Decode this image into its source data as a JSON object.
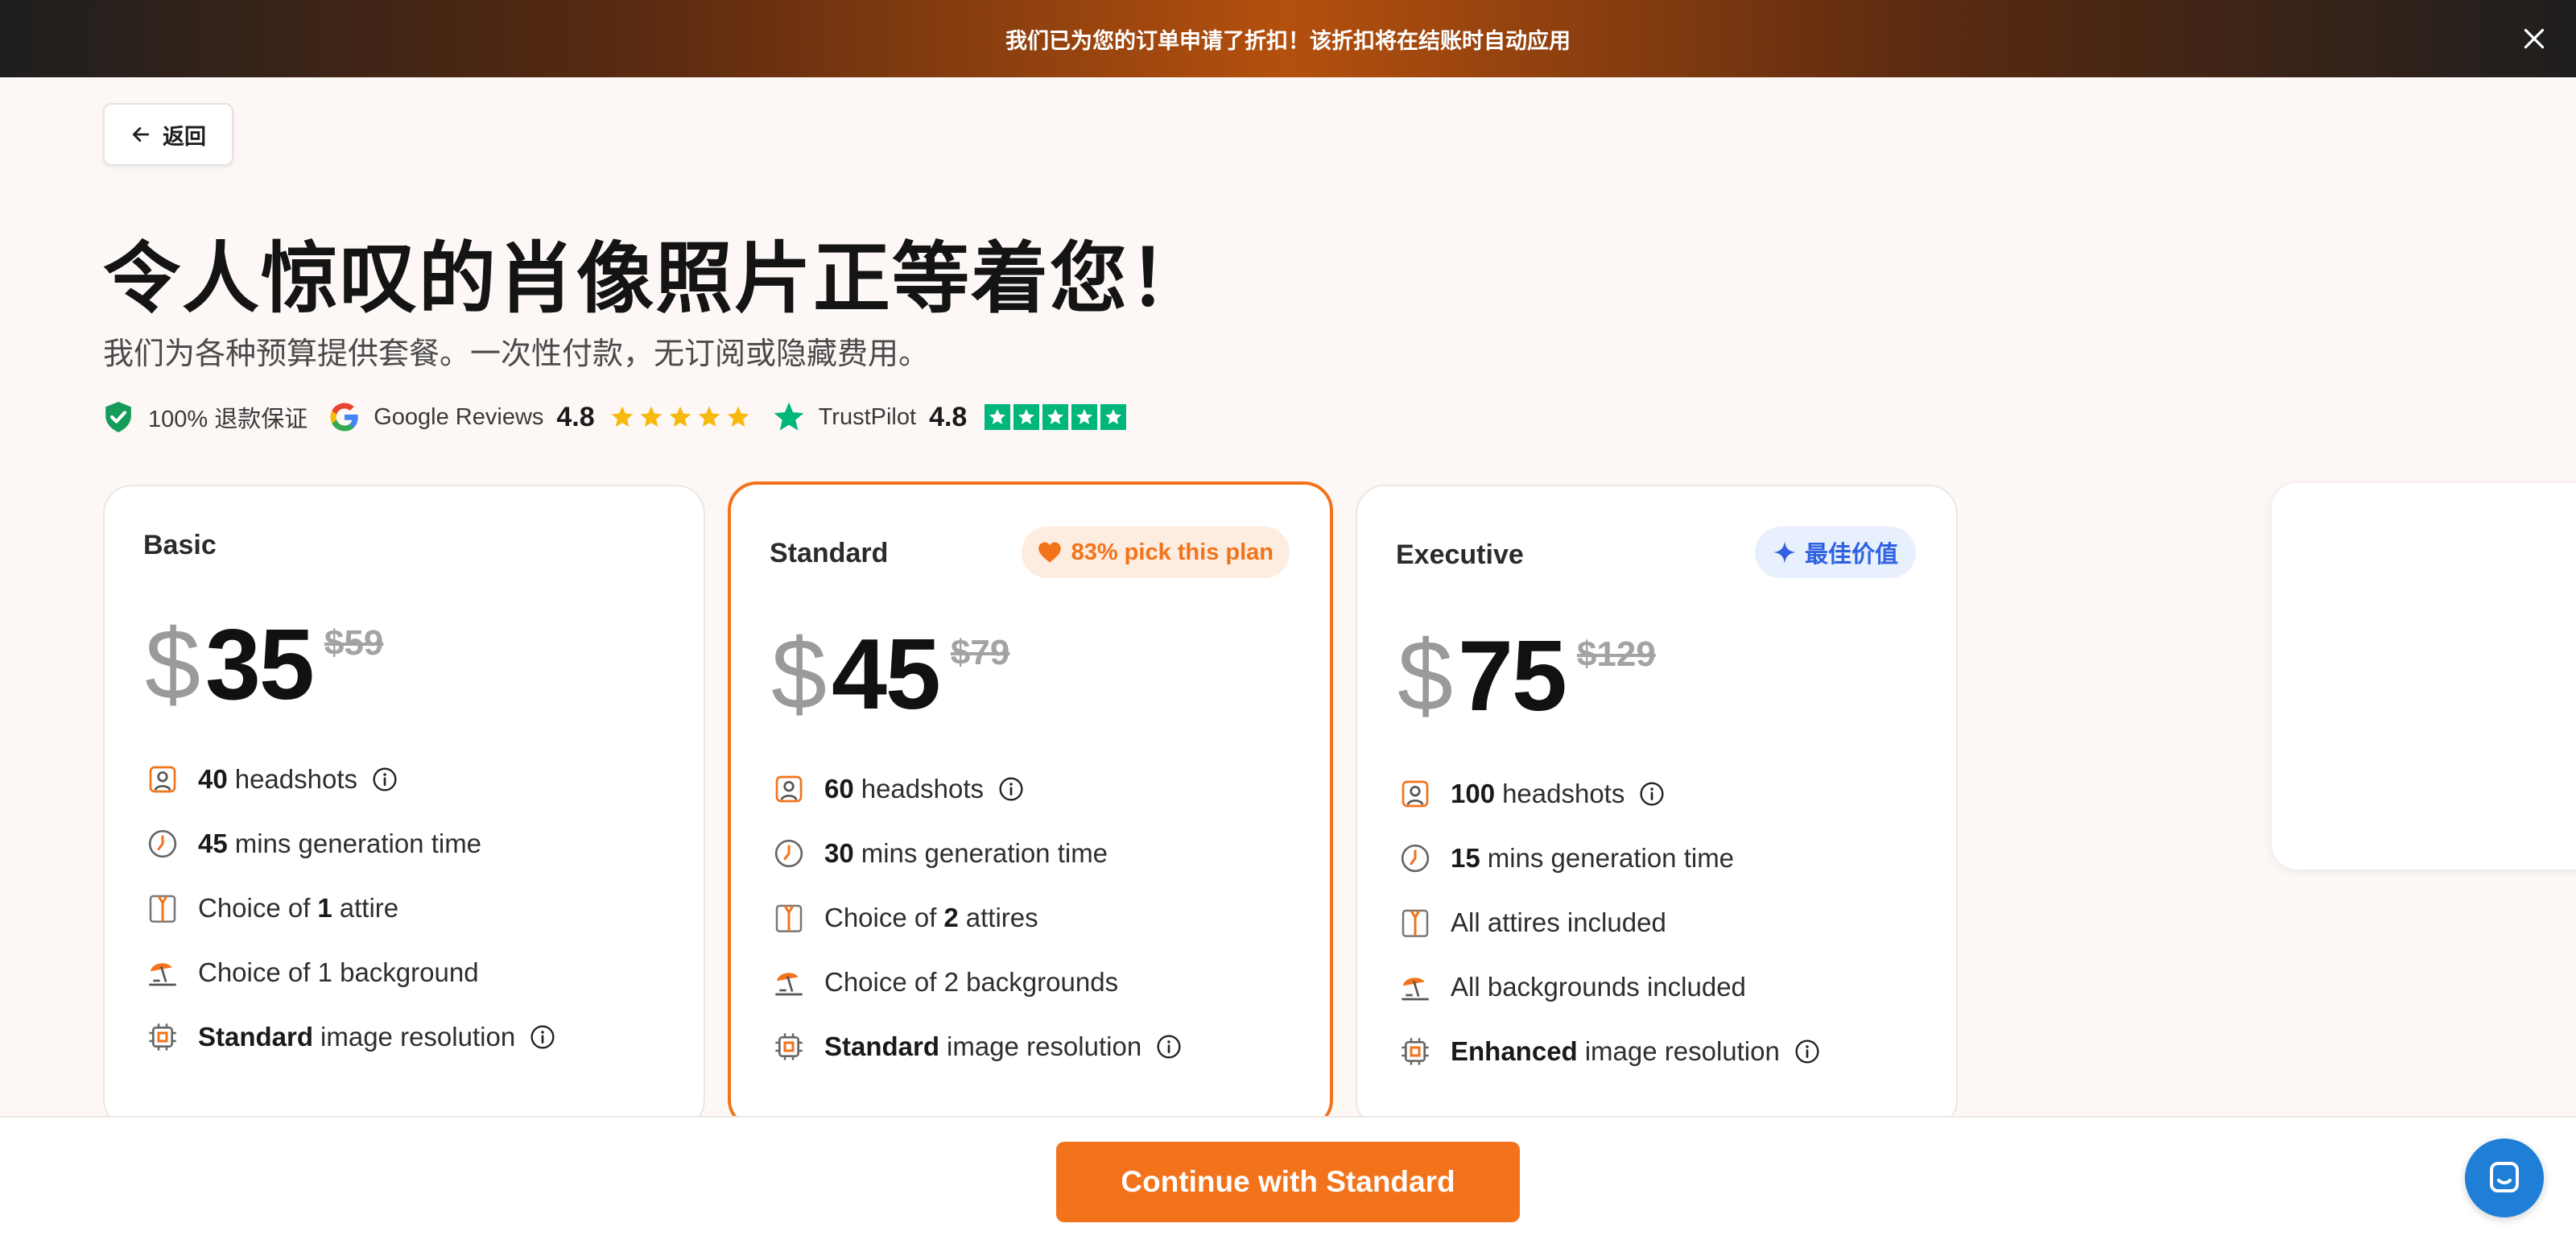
{
  "banner": {
    "text": "我们已为您的订单申请了折扣！该折扣将在结账时自动应用"
  },
  "back": {
    "label": "返回"
  },
  "title": "令人惊叹的肖像照片正等着您！",
  "subtitle": "我们为各种预算提供套餐。一次性付款，无订阅或隐藏费用。",
  "trust": {
    "guarantee": "100% 退款保证",
    "google_label": "Google Reviews",
    "google_rating": "4.8",
    "trustpilot_label": "TrustPilot",
    "trustpilot_rating": "4.8"
  },
  "colors": {
    "accent": "#f2731b",
    "value_blue": "#2f62e0",
    "trustpilot_green": "#00b67a",
    "star_gold": "#f6b90e"
  },
  "plans": [
    {
      "name": "Basic",
      "currency": "$",
      "price": "35",
      "old_price": "$59",
      "features": [
        {
          "icon": "portrait-icon",
          "bold": "40",
          "text": "headshots",
          "info": true
        },
        {
          "icon": "clock-icon",
          "bold": "45",
          "text": "mins generation time"
        },
        {
          "icon": "shirt-icon",
          "pre": "Choice of",
          "bold": "1",
          "text": "attire"
        },
        {
          "icon": "beach-umbrella-icon",
          "text": "Choice of 1 background"
        },
        {
          "icon": "chip-icon",
          "bold": "Standard",
          "text": "image resolution",
          "info": true
        }
      ]
    },
    {
      "name": "Standard",
      "badge": "83% pick this plan",
      "currency": "$",
      "price": "45",
      "old_price": "$79",
      "features": [
        {
          "icon": "portrait-icon",
          "bold": "60",
          "text": "headshots",
          "info": true
        },
        {
          "icon": "clock-icon",
          "bold": "30",
          "text": "mins generation time"
        },
        {
          "icon": "shirt-icon",
          "pre": "Choice of",
          "bold": "2",
          "text": "attires"
        },
        {
          "icon": "beach-umbrella-icon",
          "text": "Choice of 2 backgrounds"
        },
        {
          "icon": "chip-icon",
          "bold": "Standard",
          "text": "image resolution",
          "info": true
        }
      ]
    },
    {
      "name": "Executive",
      "badge": "最佳价值",
      "currency": "$",
      "price": "75",
      "old_price": "$129",
      "features": [
        {
          "icon": "portrait-icon",
          "bold": "100",
          "text": "headshots",
          "info": true
        },
        {
          "icon": "clock-icon",
          "bold": "15",
          "text": "mins generation time"
        },
        {
          "icon": "shirt-icon",
          "text": "All attires included"
        },
        {
          "icon": "beach-umbrella-icon",
          "text": "All backgrounds included"
        },
        {
          "icon": "chip-icon",
          "bold": "Enhanced",
          "text": "image resolution",
          "info": true
        }
      ]
    }
  ],
  "cta": {
    "label": "Continue with Standard"
  }
}
